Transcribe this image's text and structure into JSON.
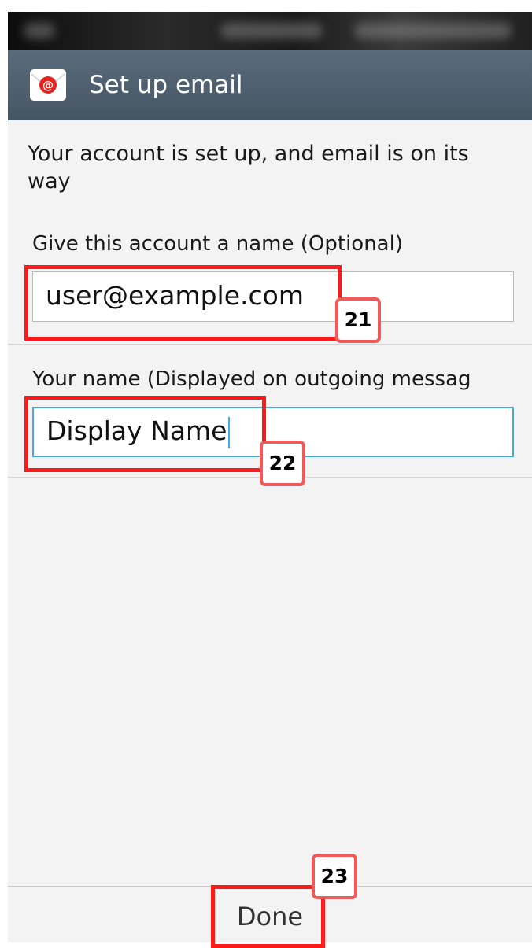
{
  "app": {
    "title": "Set up email",
    "icon": "email-app-icon"
  },
  "content": {
    "intro_text": "Your account is set up, and email is on its way",
    "account_name": {
      "label": "Give this account a name (Optional)",
      "value": "user@example.com"
    },
    "your_name": {
      "label": "Your name (Displayed on outgoing messag",
      "value": "Display Name"
    }
  },
  "footer": {
    "done_label": "Done"
  },
  "annotations": {
    "account_name_badge": "21",
    "your_name_badge": "22",
    "done_badge": "23"
  },
  "colors": {
    "action_bar": "#4f5f6f",
    "background": "#f3f3f3",
    "focus_accent": "#49a8e0",
    "annotation_red": "#ff1a1a"
  }
}
